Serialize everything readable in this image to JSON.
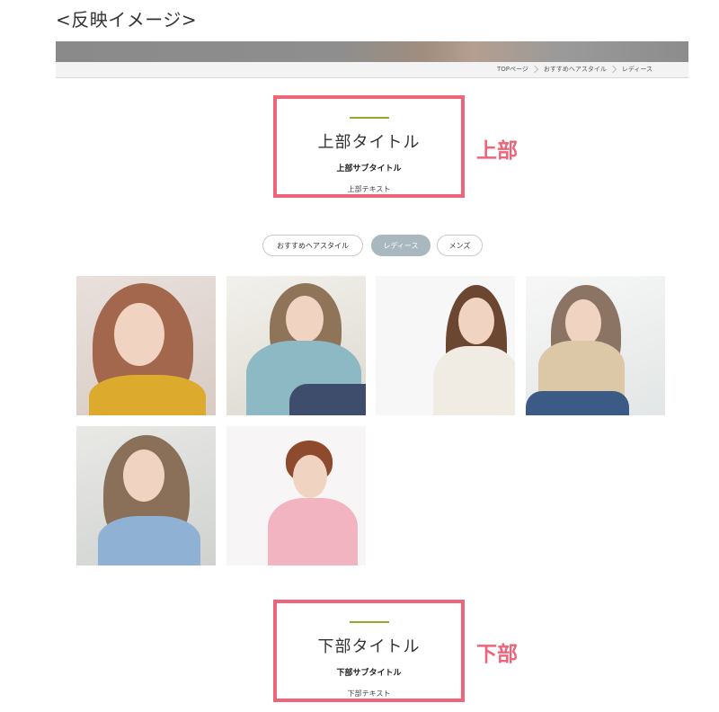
{
  "caption": "<反映イメージ>",
  "breadcrumb": [
    "TOPページ",
    "おすすめヘアスタイル",
    "レディース"
  ],
  "top_block": {
    "main_title": "上部タイトル",
    "sub_title": "上部サブタイトル",
    "text": "上部テキスト",
    "side_label": "上部"
  },
  "tabs": [
    {
      "label": "おすすめヘアスタイル",
      "active": false
    },
    {
      "label": "レディース",
      "active": true
    },
    {
      "label": "メンズ",
      "active": false
    }
  ],
  "gallery": [
    {
      "name": "hairstyle-photo-1"
    },
    {
      "name": "hairstyle-photo-2"
    },
    {
      "name": "hairstyle-photo-3"
    },
    {
      "name": "hairstyle-photo-4"
    },
    {
      "name": "hairstyle-photo-5"
    },
    {
      "name": "hairstyle-photo-6"
    }
  ],
  "bottom_block": {
    "main_title": "下部タイトル",
    "sub_title": "下部サブタイトル",
    "text": "下部テキスト",
    "side_label": "下部"
  },
  "colors": {
    "highlight": "#ee6579",
    "accent_line": "#9aa629",
    "active_tab": "#a9b8bf"
  }
}
